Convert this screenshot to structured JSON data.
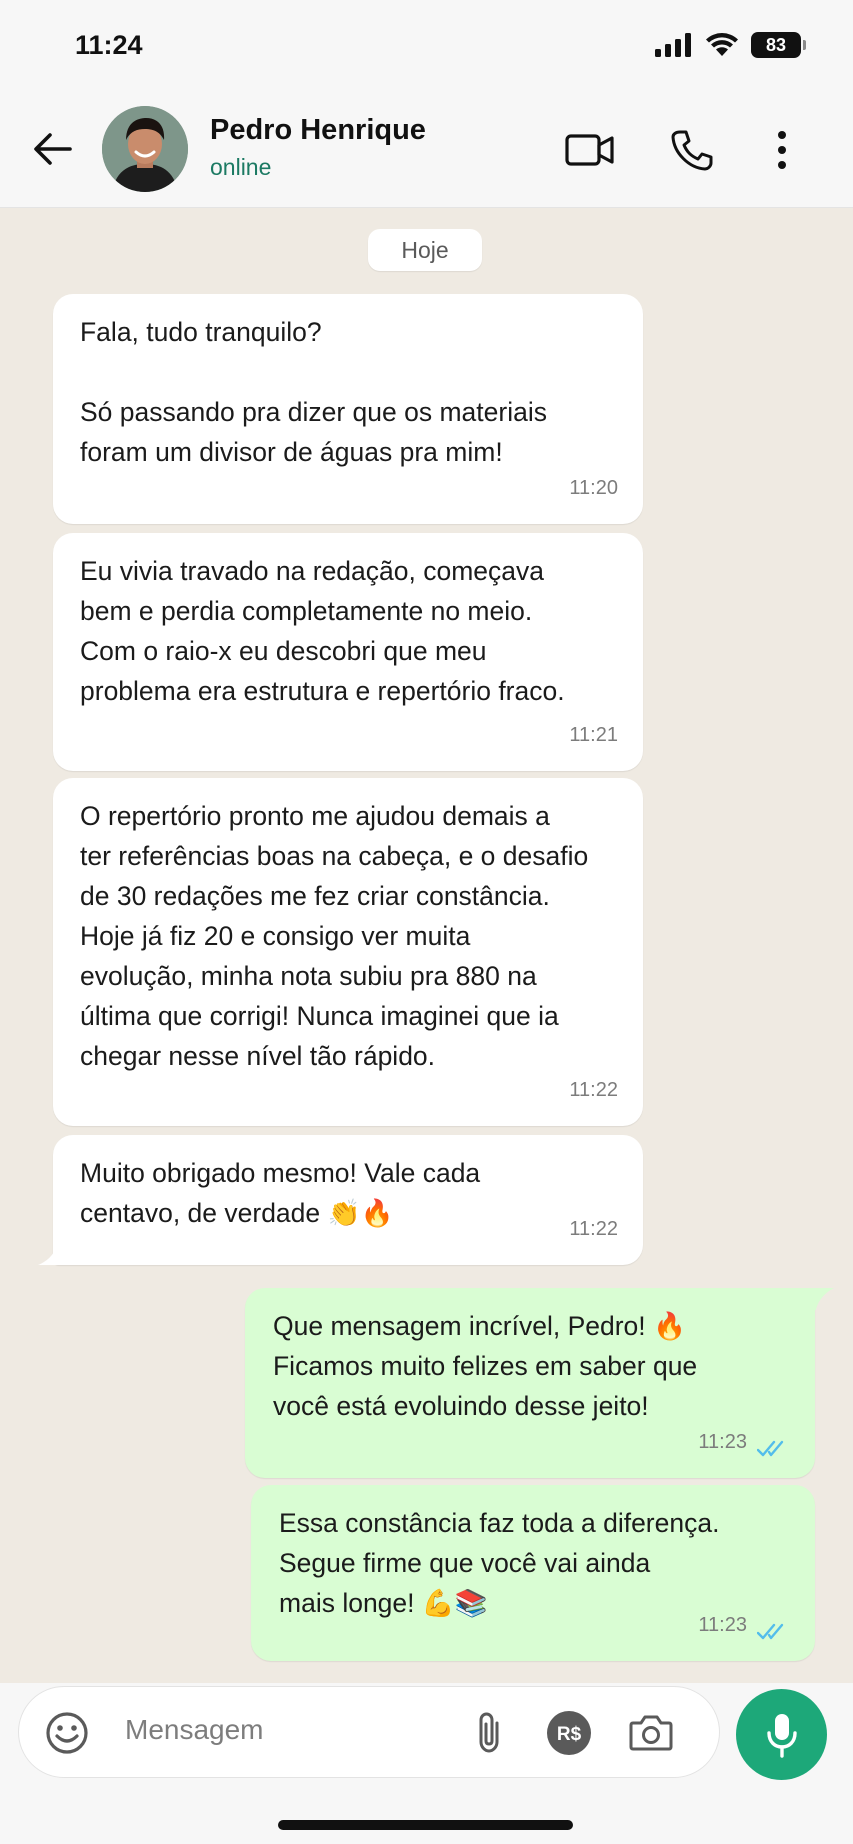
{
  "status_bar": {
    "time": "11:24",
    "battery": "83"
  },
  "header": {
    "name": "Pedro Henrique",
    "status": "online"
  },
  "chat": {
    "date_chip": "Hoje",
    "messages": [
      {
        "text": "Fala, tudo tranquilo?\n\nSó passando pra dizer que os materiais\nforam um divisor de águas pra mim!",
        "time": "11:20"
      },
      {
        "text": "Eu vivia travado na redação, começava\nbem e perdia completamente no meio.\nCom o raio-x eu descobri que meu\nproblema era estrutura e repertório fraco.",
        "time": "11:21"
      },
      {
        "text": "O repertório pronto me ajudou demais a\nter referências boas na cabeça, e o desafio\nde 30 redações me fez criar constância.\nHoje já fiz 20 e consigo ver muita\nevolução, minha nota subiu pra 880 na\núltima que corrigi! Nunca imaginei que ia\nchegar nesse nível tão rápido.",
        "time": "11:22"
      },
      {
        "text": "Muito obrigado mesmo! Vale cada\ncentavo, de verdade 👏🔥",
        "time": "11:22"
      },
      {
        "text": "Que mensagem incrível, Pedro! 🔥\nFicamos muito felizes em saber que\nvocê está evoluindo desse jeito!",
        "time": "11:23"
      },
      {
        "text": "Essa constância faz toda a diferença.\nSegue firme que você vai ainda\nmais longe! 💪📚",
        "time": "11:23"
      }
    ]
  },
  "composer": {
    "placeholder": "Mensagem",
    "currency_label": "R$",
    "icons": [
      "emoji-icon",
      "paperclip-icon",
      "payment-icon",
      "camera-icon",
      "microphone-icon"
    ]
  },
  "colors": {
    "accent": "#1da879",
    "online": "#1c7a63",
    "outgoing_bubble": "#d9fdd3",
    "incoming_bubble": "#ffffff",
    "read_ticks": "#53bdeb"
  }
}
